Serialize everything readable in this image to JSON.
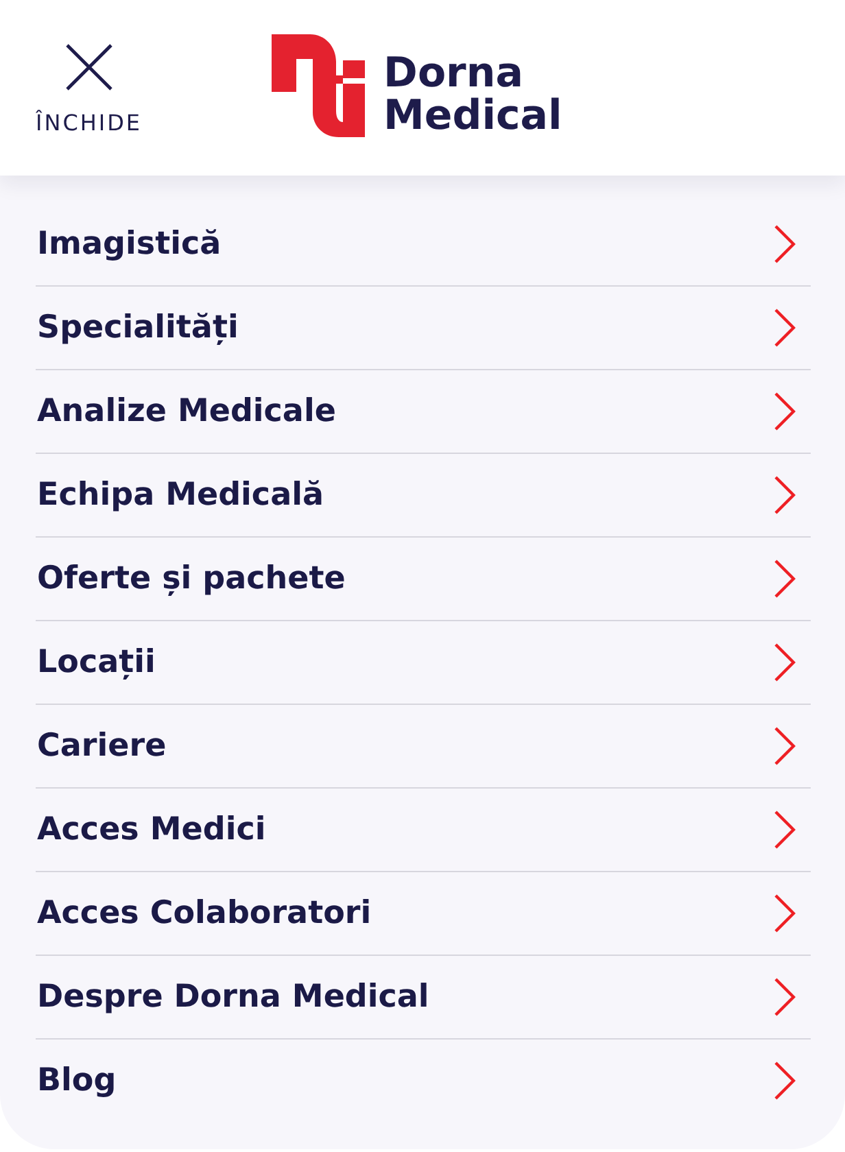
{
  "header": {
    "close_button": {
      "label": "ÎNCHIDE"
    },
    "logo": {
      "lines": [
        "Dorna",
        "Medical"
      ]
    }
  },
  "menu": {
    "items": [
      {
        "label": "Imagistică"
      },
      {
        "label": "Specialități"
      },
      {
        "label": "Analize Medicale"
      },
      {
        "label": "Echipa Medicală"
      },
      {
        "label": "Oferte și pachete"
      },
      {
        "label": "Locații"
      },
      {
        "label": "Cariere"
      },
      {
        "label": "Acces Medici"
      },
      {
        "label": "Acces Colaboratori"
      },
      {
        "label": "Despre Dorna Medical"
      },
      {
        "label": "Blog"
      }
    ]
  }
}
